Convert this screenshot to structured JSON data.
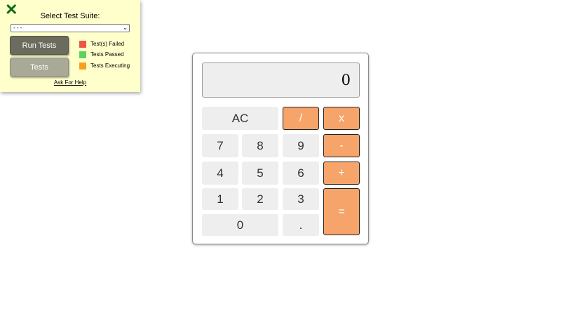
{
  "test_panel": {
    "close_glyph": "✕",
    "title": "Select Test Suite:",
    "suite_select": {
      "selected": "- - -",
      "arrow": "⌄"
    },
    "run_tests_label": "Run Tests",
    "tests_label": "Tests",
    "legend": [
      {
        "label": "Test(s) Failed",
        "color": "#ee5546"
      },
      {
        "label": "Tests Passed",
        "color": "#5dd35d"
      },
      {
        "label": "Tests Executing",
        "color": "#f7a01e"
      }
    ],
    "help_label": "Ask For Help"
  },
  "calculator": {
    "display": "0",
    "keys": {
      "clear": "AC",
      "divide": "/",
      "multiply": "x",
      "subtract": "-",
      "add": "+",
      "equals": "=",
      "decimal": ".",
      "d0": "0",
      "d1": "1",
      "d2": "2",
      "d3": "3",
      "d4": "4",
      "d5": "5",
      "d6": "6",
      "d7": "7",
      "d8": "8",
      "d9": "9"
    },
    "colors": {
      "operator": "#f7a46a",
      "key": "#eeeeee"
    }
  }
}
